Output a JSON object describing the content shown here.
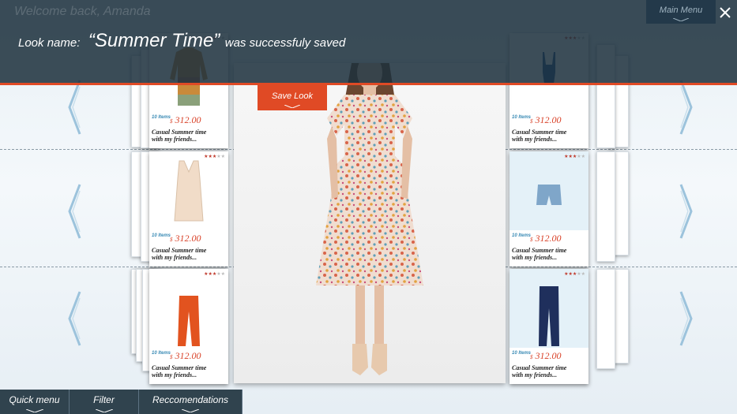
{
  "header": {
    "welcome_text": "Welcome back, Amanda",
    "main_menu_label": "Main Menu",
    "close_icon": "close-icon"
  },
  "notification": {
    "prefix": "Look name:",
    "look_name": "“Summer Time”",
    "suffix": "was successfuly saved"
  },
  "save_look_label": "Save Look",
  "colors": {
    "accent": "#e04a25",
    "bar": "#1c303c",
    "price": "#d9442b",
    "items": "#3a8bb5"
  },
  "left_cards": [
    {
      "stars": 3.5,
      "items": "10 Items",
      "currency": "$",
      "price": "312.00",
      "desc1": "Casual Summer time",
      "desc2": "with my friends...",
      "image": "sweater"
    },
    {
      "stars": 3.5,
      "items": "10 Items",
      "currency": "$",
      "price": "312.00",
      "desc1": "Casual Summer time",
      "desc2": "with my friends...",
      "image": "blouse"
    },
    {
      "stars": 3.5,
      "items": "10 Items",
      "currency": "$",
      "price": "312.00",
      "desc1": "Casual Summer time",
      "desc2": "with my friends...",
      "image": "orange-pants"
    }
  ],
  "right_cards": [
    {
      "stars": 3.5,
      "items": "10 Items",
      "currency": "$",
      "price": "312.00",
      "desc1": "Casual Summer time",
      "desc2": "with my friends...",
      "image": "swimsuit"
    },
    {
      "stars": 3.5,
      "items": "10 Items",
      "currency": "$",
      "price": "312.00",
      "desc1": "Casual Summer time",
      "desc2": "with my friends...",
      "image": "shorts"
    },
    {
      "stars": 3.5,
      "items": "10 Items",
      "currency": "$",
      "price": "312.00",
      "desc1": "Casual Summer time",
      "desc2": "with my friends...",
      "image": "jeans"
    }
  ],
  "bottom_menu": [
    {
      "label": "Quick menu"
    },
    {
      "label": "Filter"
    },
    {
      "label": "Reccomendations"
    }
  ]
}
